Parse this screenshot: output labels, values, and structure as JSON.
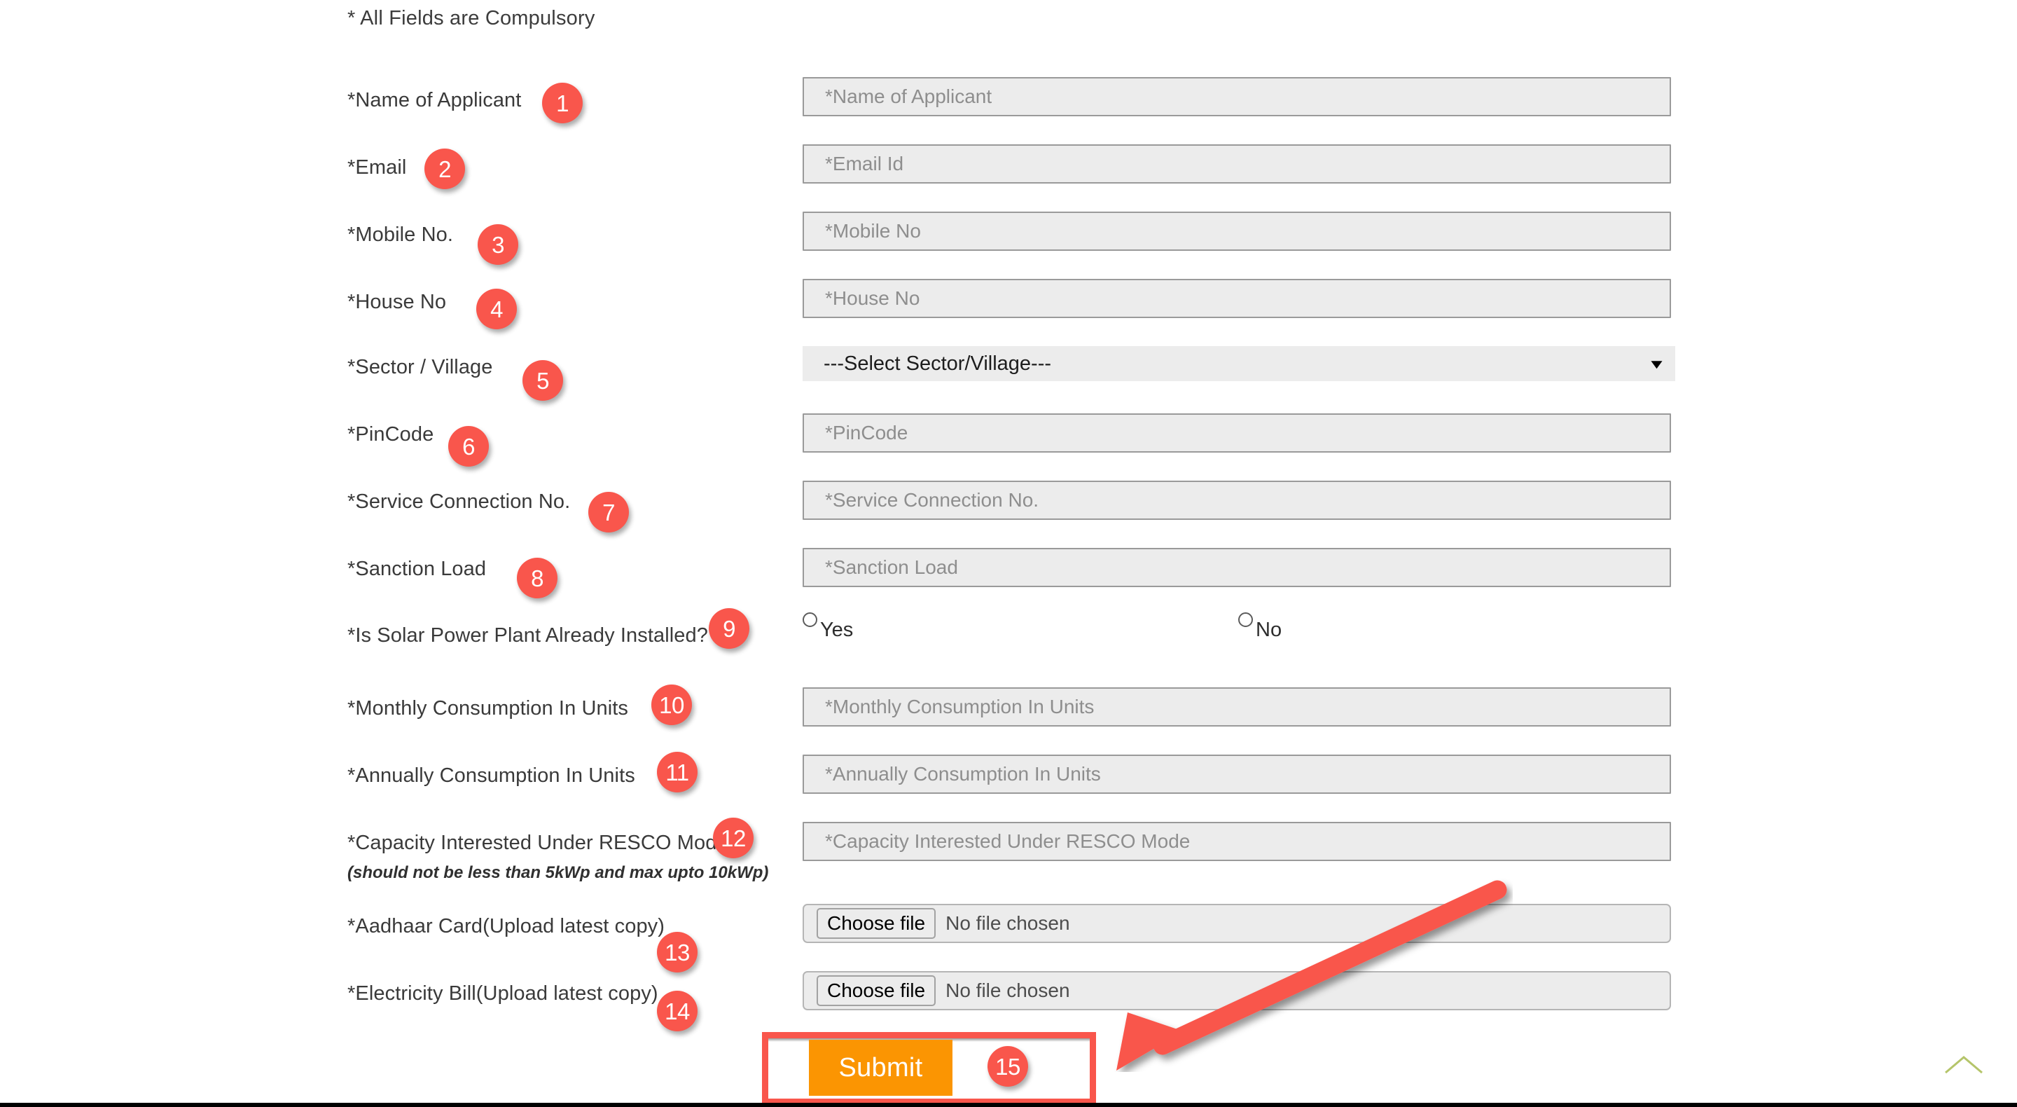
{
  "form": {
    "compulsory_note": "* All Fields are Compulsory",
    "fields": [
      {
        "label": "*Name of Applicant",
        "placeholder": "*Name of Applicant",
        "type": "text"
      },
      {
        "label": "*Email",
        "placeholder": "*Email Id",
        "type": "text"
      },
      {
        "label": "*Mobile No.",
        "placeholder": "*Mobile No",
        "type": "text"
      },
      {
        "label": "*House No",
        "placeholder": "*House No",
        "type": "text"
      },
      {
        "label": "*Sector / Village",
        "selected": "---Select Sector/Village---",
        "type": "select"
      },
      {
        "label": "*PinCode",
        "placeholder": "*PinCode",
        "type": "text"
      },
      {
        "label": "*Service Connection No.",
        "placeholder": "*Service Connection No.",
        "type": "text"
      },
      {
        "label": "*Sanction Load",
        "placeholder": "*Sanction Load",
        "type": "text"
      },
      {
        "label": "*Is Solar Power Plant Already Installed?",
        "type": "radio"
      },
      {
        "label": "*Monthly Consumption In Units",
        "placeholder": "*Monthly Consumption In Units",
        "type": "text"
      },
      {
        "label": "*Annually Consumption In Units",
        "placeholder": "*Annually Consumption In Units",
        "type": "text"
      },
      {
        "label": "*Capacity Interested Under RESCO Mode",
        "sublabel": "(should not be less than 5kWp and max upto 10kWp)",
        "placeholder": "*Capacity Interested Under RESCO Mode",
        "type": "text"
      },
      {
        "label": "*Aadhaar Card(Upload latest copy)",
        "type": "file"
      },
      {
        "label": "*Electricity Bill(Upload latest copy)",
        "type": "file"
      }
    ],
    "radio_options": [
      {
        "label": "Yes",
        "selected": false
      },
      {
        "label": "No",
        "selected": false
      }
    ],
    "file_input": {
      "button_label": "Choose file",
      "status_label": "No file chosen"
    },
    "select_chevron": "chevron-down-icon",
    "submit_label": "Submit"
  },
  "annotations": {
    "badges": [
      "1",
      "2",
      "3",
      "4",
      "5",
      "6",
      "7",
      "8",
      "9",
      "10",
      "11",
      "12",
      "13",
      "14",
      "15"
    ],
    "badge_color": "#f9564c",
    "highlight_color": "#f9564c",
    "arrow_color": "#f9564c",
    "arrow_name": "pointer-arrow"
  },
  "misc": {
    "scroll_top_icon": "chevron-up-icon",
    "scroll_top_color": "#b5c56a",
    "submit_color": "#fb9502"
  }
}
